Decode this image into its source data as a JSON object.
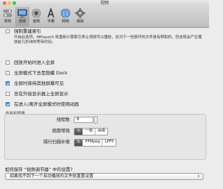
{
  "window": {
    "title": "视频",
    "colors": {
      "close": "#fc605c",
      "minimize": "#fdbc40",
      "zoom": "#34c84a",
      "selected_tab_bg": "#c9c9c9",
      "checkbox_checked": "#4a8fe6"
    }
  },
  "toolbar": {
    "tabs": [
      {
        "label": "常规",
        "icon": "switch-icon",
        "selected": false
      },
      {
        "label": "视频",
        "icon": "monitor-icon",
        "selected": true
      },
      {
        "label": "音频",
        "icon": "speaker-icon",
        "selected": false
      },
      {
        "label": "字幕",
        "icon": "font-a-icon",
        "selected": false
      },
      {
        "label": "网络",
        "icon": "globe-icon",
        "selected": false
      },
      {
        "label": "高级",
        "icon": "gear-icon",
        "selected": false
      }
    ]
  },
  "options": [
    {
      "label": "强制重建索引",
      "checked": false
    },
    {
      "label": "回放开始时进入全屏",
      "checked": false
    },
    {
      "label": "全屏模式下总是隐藏 Dock",
      "checked": false
    },
    {
      "label": "全屏时保持其他屏幕可见",
      "checked": true
    },
    {
      "label": "总在外接显示器上全屏显示",
      "checked": false
    },
    {
      "label": "在进入/离开全屏模式时使用动画",
      "checked": true
    }
  ],
  "index_description": "开启此选项，MPlayerX 将重新计算索引来让视频可以播放，这对于一些损坏的文件是有帮助的，但这将会产生播放前几秒钟的等待时间。",
  "performance": {
    "group_title": "性能和质量",
    "threads_label": "线程数",
    "threads_value": "8",
    "enhance_label": "画面增强",
    "enhance_options": [
      "无",
      "一般",
      "高级"
    ],
    "enhance_selected": 0,
    "interlace_label": "隔行扫描补偿",
    "interlace_options": [
      "无",
      "FFMpeg",
      "LPF5"
    ],
    "interlace_selected": 0
  },
  "save_settings": {
    "question": "如何保存 “视频调节器” 中的设置?",
    "selected": "如果找不到下一个自动播放的文件就重置设置"
  }
}
